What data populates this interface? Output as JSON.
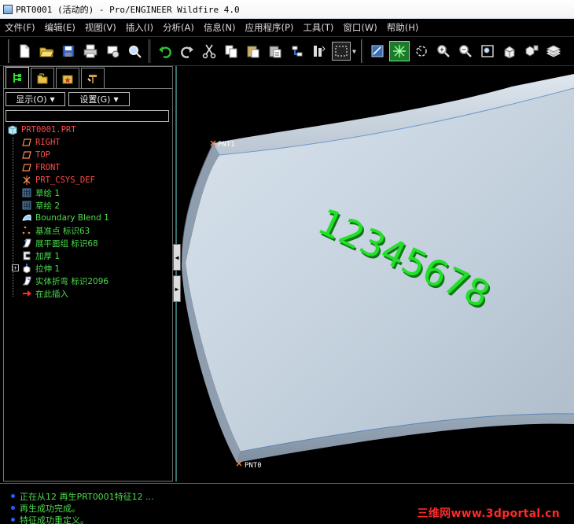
{
  "window": {
    "title": "PRT0001 (活动的) - Pro/ENGINEER Wildfire 4.0"
  },
  "menu": [
    "文件(F)",
    "编辑(E)",
    "视图(V)",
    "插入(I)",
    "分析(A)",
    "信息(N)",
    "应用程序(P)",
    "工具(T)",
    "窗口(W)",
    "帮助(H)"
  ],
  "toolbar": {
    "icons": [
      "new-file-icon",
      "open-folder-icon",
      "save-icon",
      "print-icon",
      "send-mail-icon",
      "search-icon",
      "undo-icon",
      "redo-icon",
      "cut-icon",
      "copy-icon",
      "paste-icon",
      "paste-special-icon",
      "regenerate-icon",
      "regen-manager-icon",
      "select-box-icon",
      "repaint-icon",
      "spin-center-icon",
      "orient-icon",
      "zoom-in-icon",
      "zoom-out-icon",
      "refit-icon",
      "reorient-icon",
      "saved-views-icon",
      "layers-icon"
    ]
  },
  "model_tree": {
    "tabs": [
      "model-tree-tab",
      "folder-browser-tab",
      "favorites-tab",
      "connections-tab"
    ],
    "show_dropdown": "显示(O)",
    "settings_dropdown": "设置(G)",
    "search_value": "",
    "root": "PRT0001.PRT",
    "items": [
      {
        "label": "RIGHT",
        "icon": "datum-plane-icon",
        "color": "red"
      },
      {
        "label": "TOP",
        "icon": "datum-plane-icon",
        "color": "red"
      },
      {
        "label": "FRONT",
        "icon": "datum-plane-icon",
        "color": "red"
      },
      {
        "label": "PRT_CSYS_DEF",
        "icon": "csys-icon",
        "color": "red"
      },
      {
        "label": "草绘 1",
        "icon": "sketch-icon",
        "color": "green"
      },
      {
        "label": "草绘 2",
        "icon": "sketch-icon",
        "color": "green"
      },
      {
        "label": "Boundary Blend 1",
        "icon": "boundary-blend-icon",
        "color": "green"
      },
      {
        "label": "基准点 标识63",
        "icon": "datum-point-icon",
        "color": "green"
      },
      {
        "label": "展平面组 标识68",
        "icon": "flatten-quilt-icon",
        "color": "green"
      },
      {
        "label": "加厚 1",
        "icon": "thicken-icon",
        "color": "green"
      },
      {
        "label": "拉伸 1",
        "icon": "extrude-icon",
        "color": "green"
      },
      {
        "label": "实体折弯 标识2096",
        "icon": "solid-bend-icon",
        "color": "green"
      },
      {
        "label": "在此插入",
        "icon": "insert-here-icon",
        "color": "green"
      }
    ]
  },
  "graphics": {
    "text_on_part": "12345678",
    "point_labels": [
      "PNT1",
      "PNT0"
    ],
    "accent_green": "#22e02a",
    "part_color": "#c9d7e3"
  },
  "messages": [
    "正在从12 再生PRT0001特征12 ...",
    "再生成功完成。",
    "特征成功重定义。"
  ],
  "watermark": "三维网www.3dportal.cn"
}
